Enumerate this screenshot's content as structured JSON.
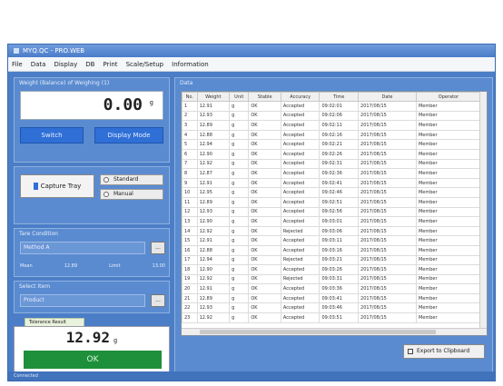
{
  "window": {
    "title": "MYQ.QC - PRO.WEB"
  },
  "menu": [
    "File",
    "Data",
    "Display",
    "DB",
    "Print",
    "Scale/Setup",
    "Information"
  ],
  "weighing": {
    "group_title": "Weight (Balance) of Weighing (1)",
    "value": "0.00",
    "unit": "g",
    "button_left": "Switch",
    "button_right": "Display Mode"
  },
  "capture": {
    "button_label": "Capture Tray",
    "option_1": "Standard",
    "option_2": "Manual"
  },
  "tare": {
    "group_title": "Tare Condition",
    "field_value": "Method A",
    "field_button": "...",
    "stats": [
      "Mean",
      "12.89",
      "Limit",
      "13.00"
    ]
  },
  "method": {
    "group_title": "Select Item",
    "field_value": "Product",
    "field_button": "..."
  },
  "result": {
    "tab_label": "Tolerance   Result",
    "value": "12.92",
    "unit": "g",
    "status": "OK"
  },
  "data_panel": {
    "group_title": "Data",
    "columns": [
      "No.",
      "Weight",
      "Unit",
      "Stable",
      "Accuracy",
      "Time",
      "Date",
      "Operator"
    ],
    "rows": [
      [
        "1",
        "12.91",
        "g",
        "OK",
        "Accepted",
        "09:02:01",
        "2017/08/15",
        "Member"
      ],
      [
        "2",
        "12.93",
        "g",
        "OK",
        "Accepted",
        "09:02:06",
        "2017/08/15",
        "Member"
      ],
      [
        "3",
        "12.89",
        "g",
        "OK",
        "Accepted",
        "09:02:11",
        "2017/08/15",
        "Member"
      ],
      [
        "4",
        "12.88",
        "g",
        "OK",
        "Accepted",
        "09:02:16",
        "2017/08/15",
        "Member"
      ],
      [
        "5",
        "12.94",
        "g",
        "OK",
        "Accepted",
        "09:02:21",
        "2017/08/15",
        "Member"
      ],
      [
        "6",
        "12.90",
        "g",
        "OK",
        "Accepted",
        "09:02:26",
        "2017/08/15",
        "Member"
      ],
      [
        "7",
        "12.92",
        "g",
        "OK",
        "Accepted",
        "09:02:31",
        "2017/08/15",
        "Member"
      ],
      [
        "8",
        "12.87",
        "g",
        "OK",
        "Accepted",
        "09:02:36",
        "2017/08/15",
        "Member"
      ],
      [
        "9",
        "12.91",
        "g",
        "OK",
        "Accepted",
        "09:02:41",
        "2017/08/15",
        "Member"
      ],
      [
        "10",
        "12.95",
        "g",
        "OK",
        "Accepted",
        "09:02:46",
        "2017/08/15",
        "Member"
      ],
      [
        "11",
        "12.89",
        "g",
        "OK",
        "Accepted",
        "09:02:51",
        "2017/08/15",
        "Member"
      ],
      [
        "12",
        "12.93",
        "g",
        "OK",
        "Accepted",
        "09:02:56",
        "2017/08/15",
        "Member"
      ],
      [
        "13",
        "12.90",
        "g",
        "OK",
        "Accepted",
        "09:03:01",
        "2017/08/15",
        "Member"
      ],
      [
        "14",
        "12.92",
        "g",
        "OK",
        "Rejected",
        "09:03:06",
        "2017/08/15",
        "Member"
      ],
      [
        "15",
        "12.91",
        "g",
        "OK",
        "Accepted",
        "09:03:11",
        "2017/08/15",
        "Member"
      ],
      [
        "16",
        "12.88",
        "g",
        "OK",
        "Accepted",
        "09:03:16",
        "2017/08/15",
        "Member"
      ],
      [
        "17",
        "12.94",
        "g",
        "OK",
        "Rejected",
        "09:03:21",
        "2017/08/15",
        "Member"
      ],
      [
        "18",
        "12.90",
        "g",
        "OK",
        "Accepted",
        "09:03:26",
        "2017/08/15",
        "Member"
      ],
      [
        "19",
        "12.92",
        "g",
        "OK",
        "Rejected",
        "09:03:31",
        "2017/08/15",
        "Member"
      ],
      [
        "20",
        "12.91",
        "g",
        "OK",
        "Accepted",
        "09:03:36",
        "2017/08/15",
        "Member"
      ],
      [
        "21",
        "12.89",
        "g",
        "OK",
        "Accepted",
        "09:03:41",
        "2017/08/15",
        "Member"
      ],
      [
        "22",
        "12.93",
        "g",
        "OK",
        "Accepted",
        "09:03:46",
        "2017/08/15",
        "Member"
      ],
      [
        "23",
        "12.92",
        "g",
        "OK",
        "Accepted",
        "09:03:51",
        "2017/08/15",
        "Member"
      ]
    ],
    "export_label": "Export to Clipboard"
  },
  "statusbar": {
    "text": "Connected"
  },
  "colors": {
    "window_bg": "#4b7ec6",
    "accent_button": "#2f6fd6",
    "ok_green": "#1e8f3a"
  }
}
